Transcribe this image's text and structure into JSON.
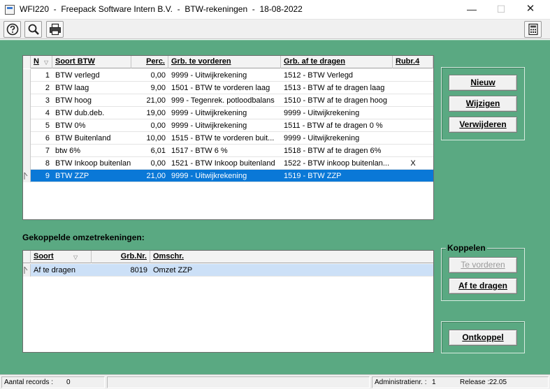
{
  "window": {
    "title": "WFI220  -  Freepack Software Intern B.V.  -  BTW-rekeningen  -  18-08-2022",
    "minimize": "—",
    "maximize": "☐",
    "close": "✕"
  },
  "toolbar": {
    "buttons": [
      "help-icon",
      "search-icon",
      "print-icon",
      "calculator-icon"
    ]
  },
  "vat_grid": {
    "columns": [
      "N",
      "Soort BTW",
      "Perc.",
      "Grb. te vorderen",
      "Grb. af te dragen",
      "Rubr.4"
    ],
    "rows": [
      {
        "n": "1",
        "soort": "BTW verlegd",
        "perc": "0,00",
        "vorderen": "9999 - Uitwijkrekening",
        "afdragen": "1512 - BTW Verlegd",
        "rubr": ""
      },
      {
        "n": "2",
        "soort": "BTW laag",
        "perc": "9,00",
        "vorderen": "1501 - BTW te vorderen laag",
        "afdragen": "1513 - BTW af te dragen laag",
        "rubr": ""
      },
      {
        "n": "3",
        "soort": "BTW hoog",
        "perc": "21,00",
        "vorderen": "999 - Tegenrek. potloodbalans",
        "afdragen": "1510 - BTW af te dragen hoog",
        "rubr": ""
      },
      {
        "n": "4",
        "soort": "BTW dub.deb.",
        "perc": "19,00",
        "vorderen": "9999 - Uitwijkrekening",
        "afdragen": "9999 - Uitwijkrekening",
        "rubr": ""
      },
      {
        "n": "5",
        "soort": "BTW 0%",
        "perc": "0,00",
        "vorderen": "9999 - Uitwijkrekening",
        "afdragen": "1511 - BTW af te dragen 0 %",
        "rubr": ""
      },
      {
        "n": "6",
        "soort": "BTW Buitenland",
        "perc": "10,00",
        "vorderen": "1515 - BTW te vorderen buit...",
        "afdragen": "9999 - Uitwijkrekening",
        "rubr": ""
      },
      {
        "n": "7",
        "soort": "btw 6%",
        "perc": "6,01",
        "vorderen": "1517 - BTW 6 %",
        "afdragen": "1518 - BTW af te dragen 6%",
        "rubr": ""
      },
      {
        "n": "8",
        "soort": "BTW Inkoop buitenlan",
        "perc": "0,00",
        "vorderen": "1521 - BTW Inkoop buitenland",
        "afdragen": "1522 - BTW inkoop buitenlan...",
        "rubr": "X"
      },
      {
        "n": "9",
        "soort": "BTW ZZP",
        "perc": "21,00",
        "vorderen": "9999 - Uitwijkrekening",
        "afdragen": "1519 - BTW ZZP",
        "rubr": ""
      }
    ],
    "selected_index": 8
  },
  "actions": {
    "new": "Nieuw",
    "edit": "Wijzigen",
    "delete": "Verwijderen"
  },
  "linked": {
    "title": "Gekoppelde omzetrekeningen:",
    "columns": [
      "Soort",
      "Grb.Nr.",
      "Omschr."
    ],
    "rows": [
      {
        "soort": "Af te dragen",
        "nr": "8019",
        "omschr": "Omzet ZZP"
      }
    ]
  },
  "koppelen": {
    "label": "Koppelen",
    "te_vorderen": "Te vorderen",
    "af_te_dragen": "Af te dragen"
  },
  "ontkoppel": "Ontkoppel",
  "status": {
    "records_label": "Aantal records :",
    "records_value": "0",
    "admin_label": "Administratienr. :",
    "admin_value": "1",
    "release_label": "Release :",
    "release_value": "22.05"
  },
  "colors": {
    "background": "#5aa982",
    "selection": "#0a78d7",
    "light_selection": "#cce0f7"
  }
}
